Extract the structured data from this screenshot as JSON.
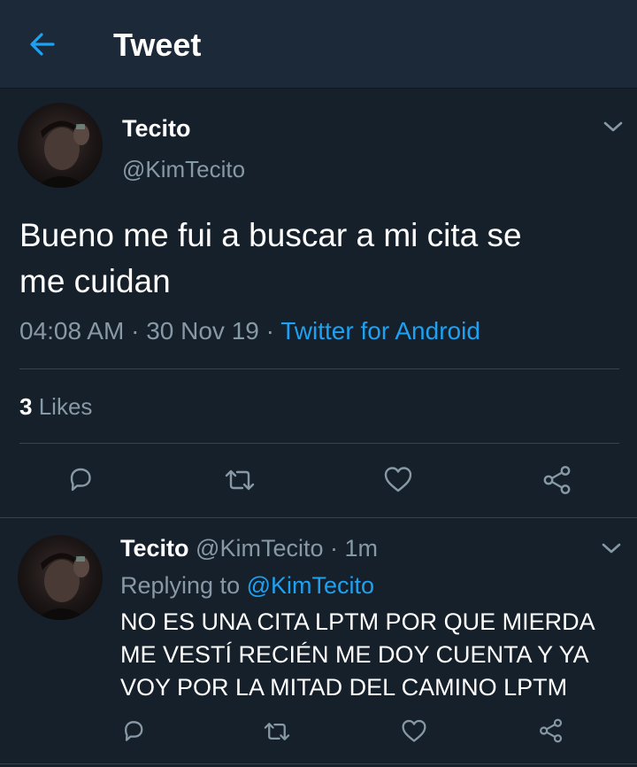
{
  "header": {
    "title": "Tweet"
  },
  "tweet": {
    "display_name": "Tecito",
    "handle": "@KimTecito",
    "text_line1": "Bueno me fui a buscar a mi cita se",
    "text_line2": "me cuidan",
    "time": "04:08 AM",
    "date": "30 Nov 19",
    "separator": "·",
    "source": "Twitter for Android",
    "likes_count": "3",
    "likes_label": "Likes"
  },
  "reply": {
    "display_name": "Tecito",
    "handle": "@KimTecito",
    "time_ago": "1m",
    "separator": "·",
    "replying_label": "Replying to",
    "replying_to": "@KimTecito",
    "text_line1": "NO ES UNA CITA LPTM POR QUE MIERDA",
    "text_line2": "ME VESTÍ RECIÉN ME DOY CUENTA Y YA",
    "text_line3": "VOY POR LA MITAD DEL CAMINO LPTM"
  },
  "colors": {
    "background": "#15202b",
    "header_background": "#1c2938",
    "accent": "#1da1f2",
    "secondary_text": "#8899a6",
    "divider": "#38444d"
  },
  "icons": [
    "back-arrow-icon",
    "chevron-down-icon",
    "reply-icon",
    "retweet-icon",
    "like-icon",
    "share-icon"
  ]
}
